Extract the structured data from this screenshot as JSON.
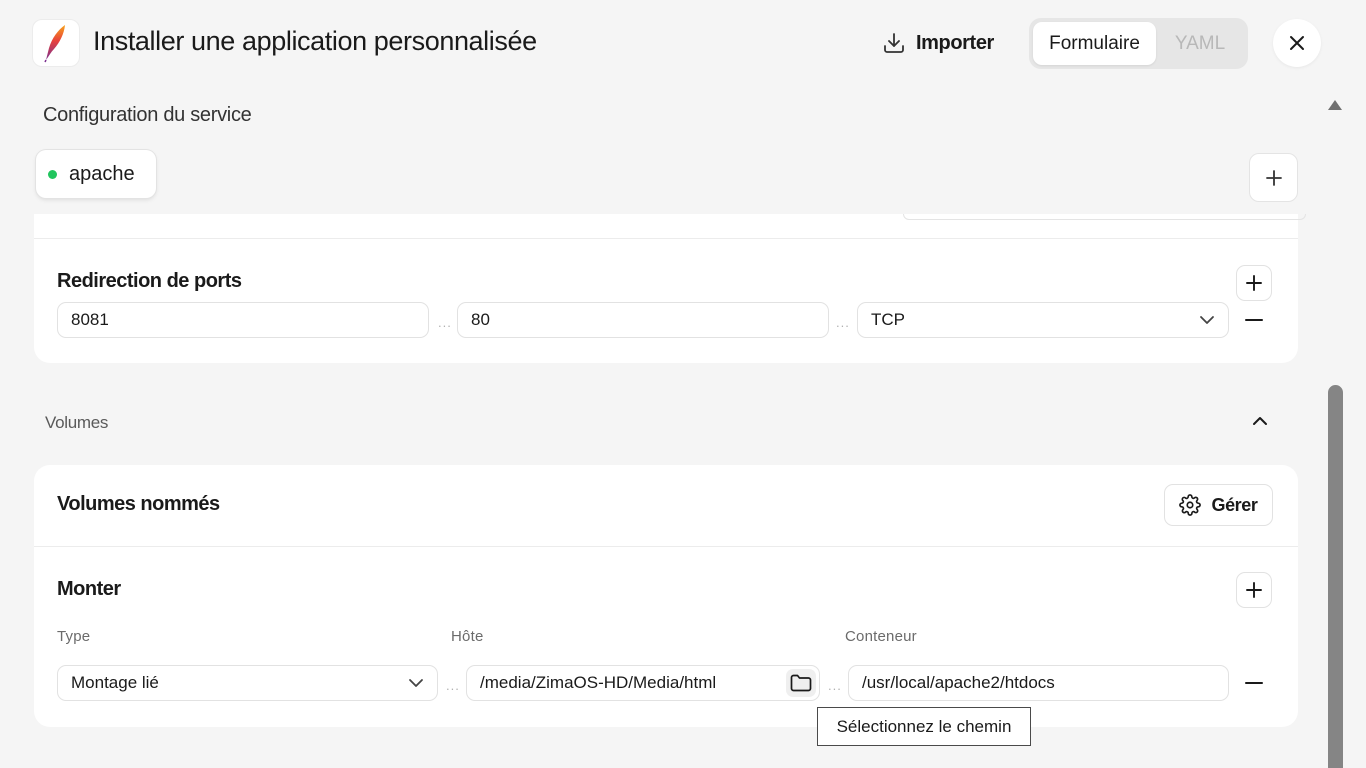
{
  "header": {
    "title": "Installer une application personnalisée",
    "import_label": "Importer",
    "mode_tabs": [
      {
        "label": "Formulaire",
        "active": true
      },
      {
        "label": "YAML",
        "active": false
      }
    ],
    "logo_icon": "apache-feather-icon"
  },
  "service": {
    "section_label": "Configuration du service",
    "chip_label": "apache",
    "chip_status_color": "#22c55e"
  },
  "ports": {
    "title": "Redirection de ports",
    "separator": "...",
    "rows": [
      {
        "host_port": "8081",
        "container_port": "80",
        "protocol": "TCP"
      }
    ]
  },
  "volumes": {
    "section_label": "Volumes",
    "named_title": "Volumes nommés",
    "manage_label": "Gérer",
    "mount_title": "Monter",
    "columns": {
      "type": "Type",
      "host": "Hôte",
      "container": "Conteneur"
    },
    "separator": "...",
    "rows": [
      {
        "type": "Montage lié",
        "host": "/media/ZimaOS-HD/Media/html",
        "container": "/usr/local/apache2/htdocs"
      }
    ]
  },
  "tooltip": "Sélectionnez le chemin"
}
